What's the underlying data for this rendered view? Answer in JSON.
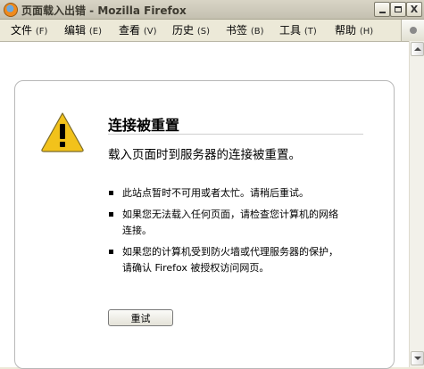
{
  "window": {
    "title": "页面载入出错 - Mozilla Firefox",
    "minimize_label": "_",
    "close_label": "X"
  },
  "menu": [
    {
      "label": "文件",
      "key": "(F)"
    },
    {
      "label": "编辑",
      "key": "(E)"
    },
    {
      "label": "查看",
      "key": "(V)"
    },
    {
      "label": "历史",
      "key": "(S)"
    },
    {
      "label": "书签",
      "key": "(B)"
    },
    {
      "label": "工具",
      "key": "(T)"
    },
    {
      "label": "帮助",
      "key": "(H)"
    }
  ],
  "error": {
    "title": "连接被重置",
    "description": "载入页面时到服务器的连接被重置。",
    "tips": [
      "此站点暂时不可用或者太忙。请稍后重试。",
      "如果您无法载入任何页面，请检查您计算机的网络连接。",
      "如果您的计算机受到防火墙或代理服务器的保护，请确认 Firefox 被授权访问网页。"
    ],
    "retry_label": "重试"
  },
  "icons": {
    "app": "firefox-icon",
    "warning": "warning-icon",
    "throbber": "throbber-icon"
  },
  "colors": {
    "warning_fill": "#f2c21b",
    "chrome": "#ece9d8"
  }
}
